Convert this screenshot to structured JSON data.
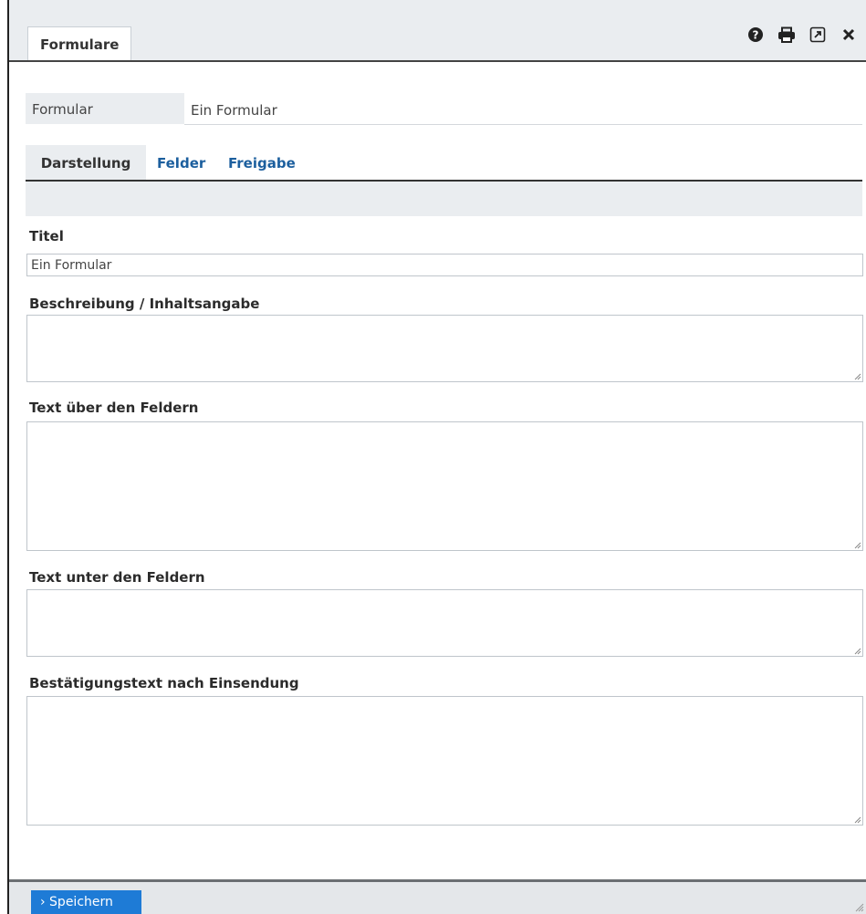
{
  "window": {
    "tab_title": "Formulare"
  },
  "header_icons": [
    "help-icon",
    "print-icon",
    "popout-icon",
    "close-icon"
  ],
  "form_name": {
    "label": "Formular",
    "value": "Ein Formular"
  },
  "tabs": [
    {
      "label": "Darstellung",
      "active": true
    },
    {
      "label": "Felder",
      "active": false
    },
    {
      "label": "Freigabe",
      "active": false
    }
  ],
  "fields": {
    "titel": {
      "label": "Titel",
      "value": "Ein Formular"
    },
    "beschreibung": {
      "label": "Beschreibung / Inhaltsangabe",
      "value": ""
    },
    "text_ueber": {
      "label": "Text über den Feldern",
      "value": ""
    },
    "text_unter": {
      "label": "Text unter den Feldern",
      "value": ""
    },
    "bestaetigung": {
      "label": "Bestätigungstext nach Einsendung",
      "value": ""
    }
  },
  "footer": {
    "save_label": "› Speichern"
  },
  "colors": {
    "accent": "#1e7bd6",
    "link": "#1c5f9e",
    "panel": "#eaedf0"
  }
}
